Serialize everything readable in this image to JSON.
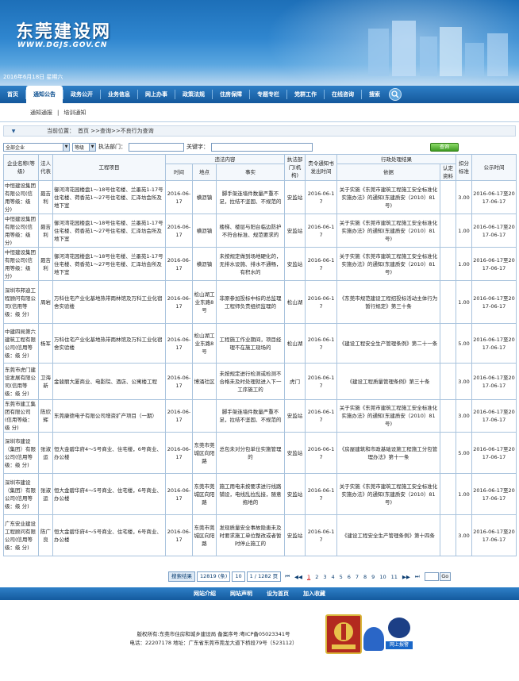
{
  "header": {
    "site_title": "东莞建设网",
    "site_url": "WWW.DGJS.GOV.CN",
    "date": "2016年6月18日 星期六"
  },
  "nav": {
    "items": [
      "首页",
      "通知公告",
      "政务公开",
      "业务信息",
      "网上办事",
      "政策法规",
      "住房保障",
      "专题专栏",
      "党群工作",
      "在线咨询"
    ],
    "active": "通知公告",
    "search_label": "搜索"
  },
  "subnav": {
    "items": [
      "通知通报",
      "|",
      "培训通知"
    ]
  },
  "breadcrumb": {
    "label": "当前位置：",
    "path": "首页 >>查询>>不良行为查询"
  },
  "filter": {
    "company_select": "全部企业",
    "grade_select": "等级",
    "dept_label": "执法部门：",
    "keyword_label": "关键字：",
    "query_button": "查询"
  },
  "table": {
    "headers": {
      "company": "企业名称(等级)",
      "person": "法人代表",
      "project": "工程项目",
      "violation": "违法内容",
      "time": "时间",
      "place": "地点",
      "fact": "事实",
      "dept": "执法部门(机构)",
      "notice": "责令通知书发出时间",
      "result": "行政处理结果",
      "basis": "依据",
      "confirm": "认定资料",
      "score": "扣分标准",
      "period": "公示时间"
    },
    "rows": [
      {
        "company": "中恒建设集团有限公司(信用等级：级 分)",
        "person": "聂吉利",
        "project": "御河湾花园楼盘1～18号住宅楼、兰墨苑1-17号住宅楼、荷香苑1～27号住宅楼、汇泽坊会所及地下室",
        "time": "2016-06-17",
        "place": "横沥镇",
        "fact": "脚手架连墙件数量严重不足，拉结不坚固、不规范的",
        "dept": "安监站",
        "notice": "2016-06-17",
        "basis": "关于实施《东莞市建筑工程施工安全标准化实施办法》的通知(东建质安（2010）81号)",
        "confirm": "",
        "score": "3.00",
        "period": "2016-06-17至2017-06-17"
      },
      {
        "company": "中恒建设集团有限公司(信用等级：级 分)",
        "person": "聂吉利",
        "project": "御河湾花园楼盘1～18号住宅楼、兰墨苑1-17号住宅楼、荷香苑1～27号住宅楼、汇泽坊会所及地下室",
        "time": "2016-06-17",
        "place": "横沥镇",
        "fact": "楼梯、楼层与阳台临边防护不符合标准、规范要求的",
        "dept": "安监站",
        "notice": "2016-06-17",
        "basis": "关于实施《东莞市建筑工程施工安全标准化实施办法》的通知(东建质安（2010）81号)",
        "confirm": "",
        "score": "1.00",
        "period": "2016-06-17至2017-06-17"
      },
      {
        "company": "中恒建设集团有限公司(信用等级：级 分)",
        "person": "聂吉利",
        "project": "御河湾花园楼盘1～18号住宅楼、兰墨苑1-17号住宅楼、荷香苑1～27号住宅楼、汇泽坊会所及地下室",
        "time": "2016-06-17",
        "place": "横沥镇",
        "fact": "未按规定做到场地硬化的，无排水设施、排水不通畅，有积水的",
        "dept": "安监站",
        "notice": "2016-06-17",
        "basis": "关于实施《东莞市建筑工程施工安全标准化实施办法》的通知(东建质安（2010）81号)",
        "confirm": "",
        "score": "1.00",
        "period": "2016-06-17至2017-06-17"
      },
      {
        "company": "深圳市邦迪工程顾问有限公司(信用等级：级 分)",
        "person": "周岩",
        "project": "万科住宅产业化基地热带雨林馆及万科工业化宿舍实验楼",
        "time": "2016-06-17",
        "place": "松山湖工业东路8号",
        "fact": "非原参加投标中标的总监理工程师负责组织监理的",
        "dept": "松山湖",
        "notice": "2016-06-17",
        "basis": "《东莞市规范建设工程招投标活动主体行为暂行规定》第三十条",
        "confirm": "",
        "score": "1.00",
        "period": "2016-06-17至2017-06-17"
      },
      {
        "company": "中建四局第六建筑工程有限公司(信用等级：级 分)",
        "person": "杨军",
        "project": "万科住宅产业化基地热带雨林馆及万科工业化宿舍实验楼",
        "time": "2016-06-17",
        "place": "松山湖工业东路8号",
        "fact": "工程施工作业期间，项目经理不在施工现场的",
        "dept": "松山湖",
        "notice": "2016-06-17",
        "basis": "《建设工程安全生产管理条例》第二十一条",
        "confirm": "",
        "score": "5.00",
        "period": "2016-06-17至2017-06-17"
      },
      {
        "company": "东莞市虎门建设发展有限公司(信用等级：级 分)",
        "person": "卫海新",
        "project": "金骏丽大厦商业、电影院、酒店、公寓楼工程",
        "time": "2016-06-17",
        "place": "博涌社区",
        "fact": "未按规定进行检测或检测不合格未及时处理就进入下一工序施工的",
        "dept": "虎门",
        "notice": "2016-06-17",
        "basis": "《建设工程质量管理条例》第三十条",
        "confirm": "",
        "score": "3.00",
        "period": "2016-06-17至2017-06-17"
      },
      {
        "company": "东莞市建工集团有限公司(信用等级：级 分)",
        "person": "陈欣辉",
        "project": "东莞康德电子有限公司增资扩产项目（一期）",
        "time": "2016-06-17",
        "place": "",
        "fact": "脚手架连墙件数量严重不足，拉结不坚固、不规范的",
        "dept": "安监站",
        "notice": "2016-06-17",
        "basis": "关于实施《东莞市建筑工程施工安全标准化实施办法》的通知(东建质安（2010）81号)",
        "confirm": "",
        "score": "3.00",
        "period": "2016-06-17至2017-06-17"
      },
      {
        "company": "深圳市建设（集团）有限公司(信用等级：级 分)",
        "person": "张淑运",
        "project": "恒大金碧华府4～5号商业、住宅楼，6号商业、办公楼",
        "time": "2016-06-17",
        "place": "东莞市莞城区向阳路",
        "fact": "总包未对分包单位实施管理的",
        "dept": "安监站",
        "notice": "2016-06-17",
        "basis": "《房屋建筑和市政基础设施工程施工分包管理办法》第十一条",
        "confirm": "",
        "score": "5.00",
        "period": "2016-06-17至2017-06-17"
      },
      {
        "company": "深圳市建设（集团）有限公司(信用等级：级 分)",
        "person": "张淑运",
        "project": "恒大金碧华府4～5号商业、住宅楼，6号商业、办公楼",
        "time": "2016-06-17",
        "place": "东莞市莞城区向阳路",
        "fact": "施工用电未按要求进行线路铺设，电线乱拉乱接，随意拖地的",
        "dept": "安监站",
        "notice": "2016-06-17",
        "basis": "关于实施《东莞市建筑工程施工安全标准化实施办法》的通知(东建质安（2010）81号)",
        "confirm": "",
        "score": "1.00",
        "period": "2016-06-17至2017-06-17"
      },
      {
        "company": "广东安业建设工程顾问有限公司(信用等级：级 分)",
        "person": "陈广良",
        "project": "恒大金碧华府4～5号商业、住宅楼，6号商业、办公楼",
        "time": "2016-06-17",
        "place": "东莞市莞城区向阳路",
        "fact": "发现质量安全事故隐患未及时要求施工单位整改或者暂时停止施工的",
        "dept": "安监站",
        "notice": "2016-06-17",
        "basis": "《建设工程安全生产管理条例》第十四条",
        "confirm": "",
        "score": "3.00",
        "period": "2016-06-17至2017-06-17"
      }
    ]
  },
  "pager": {
    "results_label": "搜索结果",
    "total": "12819 (条)",
    "per_page": "10",
    "page_info": "1 / 1282 页",
    "first": "⏮",
    "prev": "◀◀",
    "pages": [
      "1",
      "2",
      "3",
      "4",
      "5",
      "6",
      "7",
      "8",
      "9",
      "10",
      "11"
    ],
    "current": "1",
    "next": "▶▶",
    "last": "⏭",
    "go": "Go"
  },
  "footer": {
    "links": [
      "网站介绍",
      "网站声明",
      "设为首页",
      "加入收藏"
    ],
    "line1": "版权所有:东莞市住房和城乡建设局 备案序号:粤ICP备05023341号",
    "line2": "电话：22207178 地址：广东省东莞市莞龙大道下桥段79号（523112）",
    "badge_police": "网上报警"
  }
}
